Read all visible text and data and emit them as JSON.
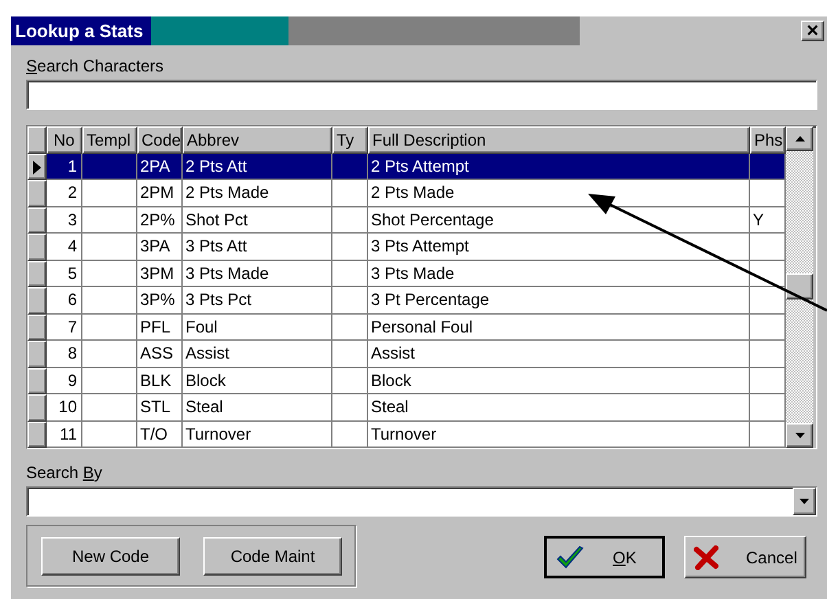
{
  "window": {
    "title": "Lookup a Stats",
    "close": "×"
  },
  "search": {
    "label": {
      "key": "S",
      "after": "earch Characters"
    }
  },
  "table": {
    "columns": [
      "No",
      "Templ",
      "Code",
      "Abbrev",
      "Ty",
      "Full Description",
      "Phs"
    ],
    "rows": [
      {
        "no": "1",
        "code": "2PA",
        "abbrev": "2 Pts Att",
        "full": "2 Pts Attempt",
        "selected": true
      },
      {
        "no": "2",
        "code": "2PM",
        "abbrev": "2 Pts Made",
        "full": "2 Pts Made",
        "selected": false
      },
      {
        "no": "3",
        "code": "2P%",
        "abbrev": "Shot Pct",
        "full": "Shot Percentage",
        "phs": "Y",
        "selected": false
      },
      {
        "no": "4",
        "code": "3PA",
        "abbrev": "3 Pts Att",
        "full": "3 Pts Attempt",
        "selected": false
      },
      {
        "no": "5",
        "code": "3PM",
        "abbrev": "3 Pts Made",
        "full": "3 Pts Made",
        "selected": false
      },
      {
        "no": "6",
        "code": "3P%",
        "abbrev": "3 Pts Pct",
        "full": "3 Pt Percentage",
        "selected": false
      },
      {
        "no": "7",
        "code": "PFL",
        "abbrev": "Foul",
        "full": "Personal Foul",
        "selected": false
      },
      {
        "no": "8",
        "code": "ASS",
        "abbrev": "Assist",
        "full": "Assist",
        "selected": false
      },
      {
        "no": "9",
        "code": "BLK",
        "abbrev": "Block",
        "full": "Block",
        "selected": false
      },
      {
        "no": "10",
        "code": "STL",
        "abbrev": "Steal",
        "full": "Steal",
        "selected": false
      },
      {
        "no": "11",
        "code": "T/O",
        "abbrev": "Turnover",
        "full": "Turnover",
        "selected": false
      }
    ]
  },
  "search_by": {
    "label": {
      "before": "Search ",
      "key": "B",
      "after": "y"
    }
  },
  "buttons": [
    {
      "kind": "plain",
      "label": {
        "after": "New Code"
      }
    },
    {
      "kind": "plain",
      "label": {
        "after": "Code Maint"
      }
    },
    {
      "kind": "ok",
      "label": {
        "key": "O",
        "after": "K"
      }
    },
    {
      "kind": "cancel",
      "label": {
        "after": "Cancel"
      }
    }
  ]
}
